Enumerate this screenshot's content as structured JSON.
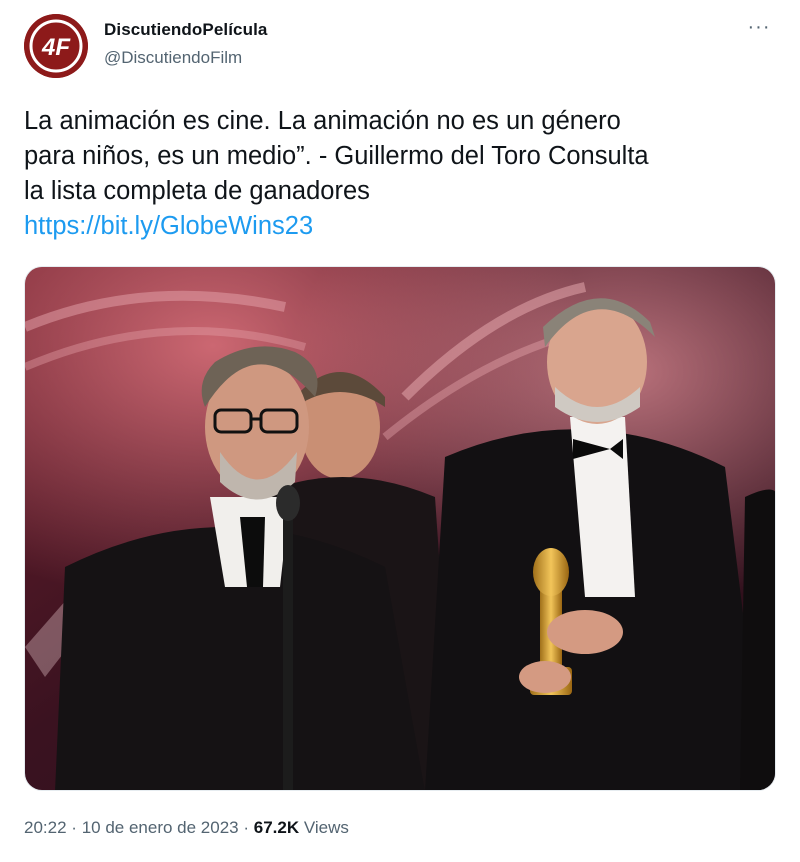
{
  "tweet": {
    "author": {
      "display_name": "DiscutiendoPelícula",
      "handle": "@DiscutiendoFilm",
      "avatar_text": "4F"
    },
    "more_label": "···",
    "text_lines": [
      "La animación es cine. La animación no es un género",
      "para niños, es un medio”. - Guillermo del Toro Consulta",
      "la lista completa de ganadores"
    ],
    "link": "https://bit.ly/GlobeWins23",
    "media": {
      "description_icon": "photo-icon"
    },
    "time": "20:22",
    "separator": "·",
    "date": "10 de enero de 2023",
    "views_count": "67.2K",
    "views_label": "Views"
  },
  "colors": {
    "link": "#1d9bf0",
    "secondary_text": "#536471",
    "avatar_bg": "#8d1a1a"
  }
}
